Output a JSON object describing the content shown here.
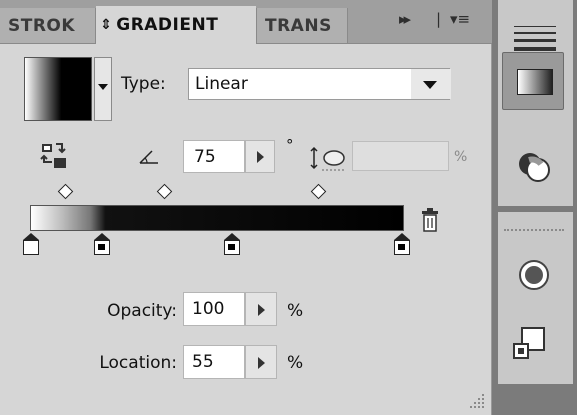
{
  "tabs": [
    {
      "label": "STROK"
    },
    {
      "label": "GRADIENT",
      "sort_icon": "⇕"
    },
    {
      "label": "TRANS"
    }
  ],
  "tab_controls": {
    "forward_icon": "▸▸",
    "separator": "|",
    "menu_icon": "▾≡"
  },
  "type": {
    "label": "Type:",
    "value": "Linear"
  },
  "angle": {
    "value": "75",
    "degree_symbol": "°"
  },
  "aspect": {
    "value": "",
    "unit": "%"
  },
  "opacity": {
    "label": "Opacity:",
    "value": "100",
    "unit": "%"
  },
  "location": {
    "label": "Location:",
    "value": "55",
    "unit": "%"
  },
  "gradient_stops": [
    {
      "color": "#ffffff",
      "position": 0
    },
    {
      "color": "#000000",
      "position": 20
    },
    {
      "color": "#000000",
      "position": 55
    },
    {
      "color": "#000000",
      "position": 100
    }
  ],
  "midpoints": [
    10,
    37,
    78
  ],
  "icons": {
    "reverse": "reverse-gradient-icon",
    "angle": "angle-icon",
    "aspect": "aspect-ratio-icon",
    "trash": "trash-icon",
    "lines": "stroke-lines-icon",
    "gradient_tool": "gradient-tool-icon",
    "transparency": "transparency-icon",
    "appearance": "appearance-icon",
    "align": "align-icon"
  }
}
